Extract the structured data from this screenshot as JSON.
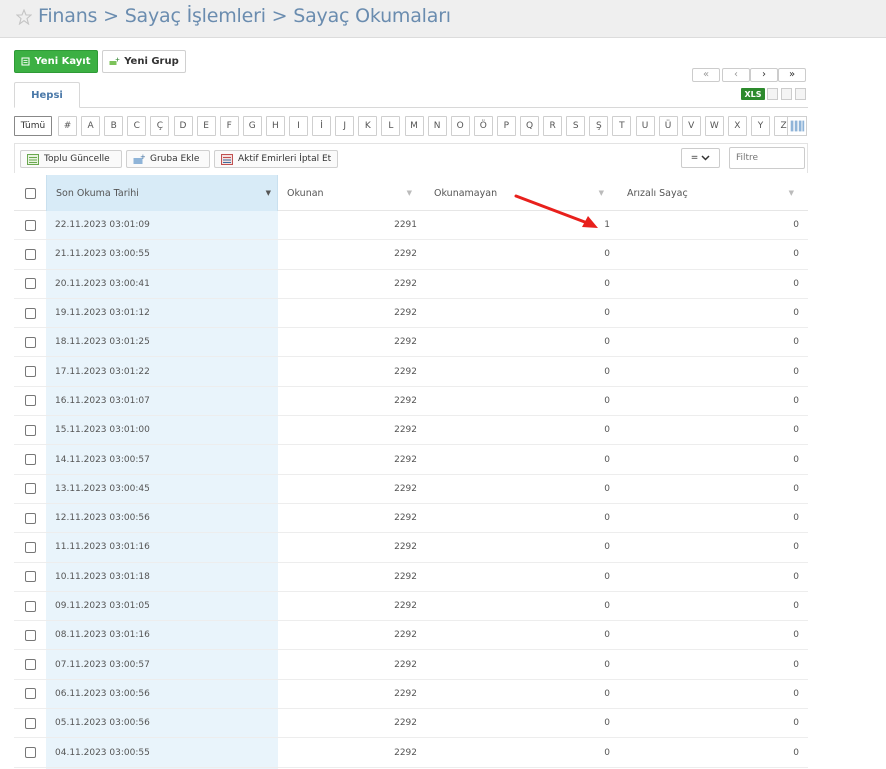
{
  "breadcrumb": {
    "part1": "Finans",
    "sep1": ">",
    "part2": "Sayaç İşlemleri",
    "sep2": ">",
    "part3": "Sayaç Okumaları"
  },
  "actions": {
    "new_record": "Yeni Kayıt",
    "new_group": "Yeni Grup"
  },
  "pager": {
    "first": "«",
    "prev": "‹",
    "next": "›",
    "last": "»"
  },
  "export": {
    "xls": "XLS"
  },
  "tabs": [
    {
      "label": "Hepsi"
    }
  ],
  "letters": [
    "Tümü",
    "#",
    "A",
    "B",
    "C",
    "Ç",
    "D",
    "E",
    "F",
    "G",
    "H",
    "I",
    "İ",
    "J",
    "K",
    "L",
    "M",
    "N",
    "O",
    "Ö",
    "P",
    "Q",
    "R",
    "S",
    "Ş",
    "T",
    "U",
    "Ü",
    "V",
    "W",
    "X",
    "Y",
    "Z"
  ],
  "toolbar": {
    "bulk_update": "Toplu Güncelle",
    "add_to_group": "Gruba Ekle",
    "cancel_orders": "Aktif Emirleri İptal Et",
    "operator": "=",
    "filter_placeholder": "Filtre"
  },
  "table": {
    "columns": [
      "Son Okuma Tarihi",
      "Okunan",
      "Okunamayan",
      "Arızalı Sayaç"
    ],
    "rows": [
      [
        "22.11.2023 03:01:09",
        "2291",
        "1",
        "0"
      ],
      [
        "21.11.2023 03:00:55",
        "2292",
        "0",
        "0"
      ],
      [
        "20.11.2023 03:00:41",
        "2292",
        "0",
        "0"
      ],
      [
        "19.11.2023 03:01:12",
        "2292",
        "0",
        "0"
      ],
      [
        "18.11.2023 03:01:25",
        "2292",
        "0",
        "0"
      ],
      [
        "17.11.2023 03:01:22",
        "2292",
        "0",
        "0"
      ],
      [
        "16.11.2023 03:01:07",
        "2292",
        "0",
        "0"
      ],
      [
        "15.11.2023 03:01:00",
        "2292",
        "0",
        "0"
      ],
      [
        "14.11.2023 03:00:57",
        "2292",
        "0",
        "0"
      ],
      [
        "13.11.2023 03:00:45",
        "2292",
        "0",
        "0"
      ],
      [
        "12.11.2023 03:00:56",
        "2292",
        "0",
        "0"
      ],
      [
        "11.11.2023 03:01:16",
        "2292",
        "0",
        "0"
      ],
      [
        "10.11.2023 03:01:18",
        "2292",
        "0",
        "0"
      ],
      [
        "09.11.2023 03:01:05",
        "2292",
        "0",
        "0"
      ],
      [
        "08.11.2023 03:01:16",
        "2292",
        "0",
        "0"
      ],
      [
        "07.11.2023 03:00:57",
        "2292",
        "0",
        "0"
      ],
      [
        "06.11.2023 03:00:56",
        "2292",
        "0",
        "0"
      ],
      [
        "05.11.2023 03:00:56",
        "2292",
        "0",
        "0"
      ],
      [
        "04.11.2023 03:00:55",
        "2292",
        "0",
        "0"
      ]
    ]
  },
  "colors": {
    "green": "#3cb043",
    "link": "#6a8caf",
    "highlight_col": "#e9f4fb",
    "arrow": "#e8201c"
  },
  "icons": [
    "star-icon",
    "document-icon",
    "group-add-icon",
    "list-icon",
    "columns-icon",
    "chevron-down-icon",
    "sort-caret-icon"
  ]
}
